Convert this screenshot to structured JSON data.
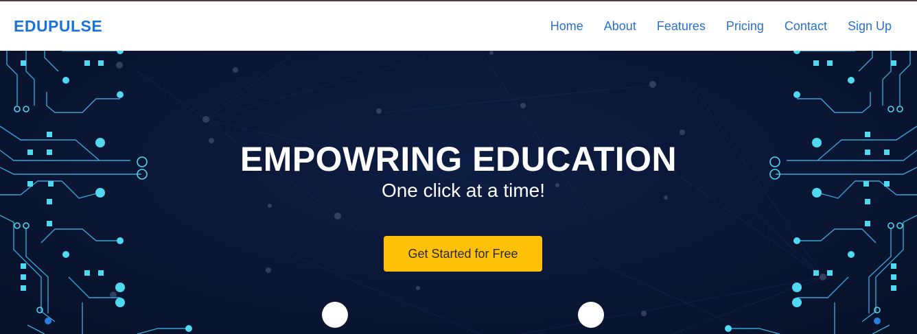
{
  "brand": {
    "name": "EDUPULSE"
  },
  "nav": {
    "items": [
      {
        "label": "Home"
      },
      {
        "label": "About"
      },
      {
        "label": "Features"
      },
      {
        "label": "Pricing"
      },
      {
        "label": "Contact"
      },
      {
        "label": "Sign Up"
      }
    ]
  },
  "hero": {
    "title": "EMPOWRING EDUCATION",
    "subtitle": "One click at a time!",
    "cta_label": "Get Started for Free",
    "background_motif": "circuit-board"
  },
  "colors": {
    "brand": "#1a73d9",
    "nav_link": "#2a72c9",
    "hero_bg": "#0a1634",
    "circuit": "#4fd8f0",
    "cta": "#ffc107"
  }
}
